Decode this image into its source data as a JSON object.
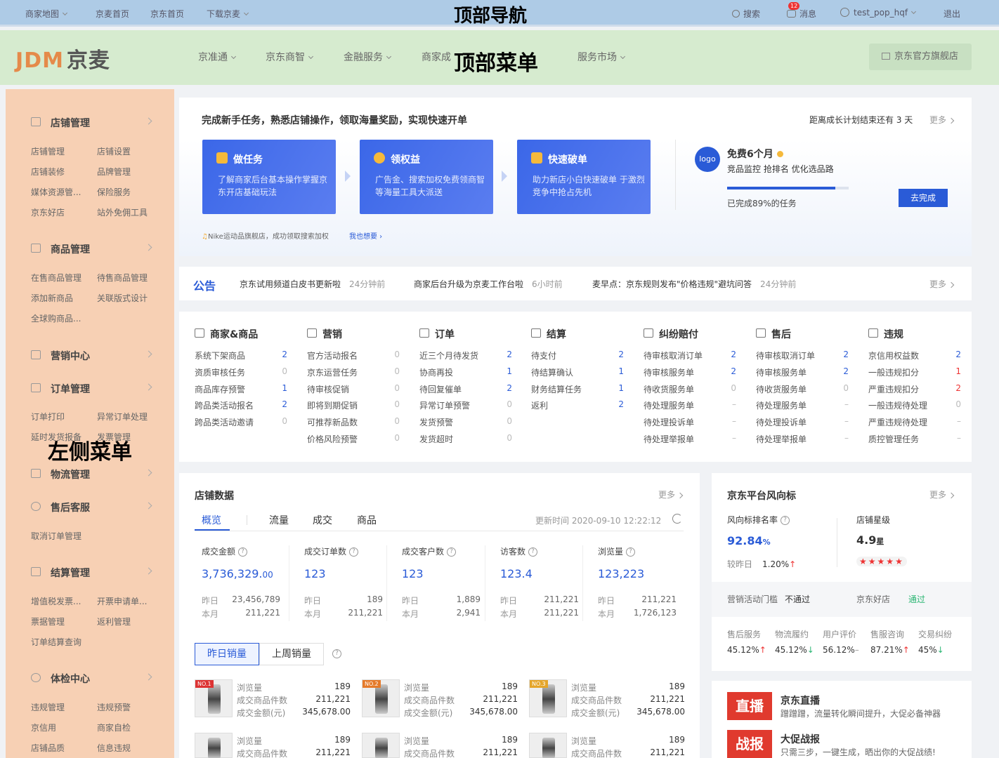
{
  "topbar": {
    "links": [
      "商家地图",
      "京麦首页",
      "京东首页",
      "下载京麦"
    ],
    "overlay": "顶部导航",
    "search": "搜索",
    "msg_badge": "12",
    "msg": "消息",
    "user": "test_pop_hqf",
    "logout": "退出"
  },
  "header": {
    "logo_en": "JDM",
    "logo_cn": "京麦",
    "menus": [
      "京准通",
      "京东商智",
      "金融服务",
      "商家成",
      "服务市场"
    ],
    "overlay": "顶部菜单",
    "store_btn": "京东官方旗舰店"
  },
  "sidebar": {
    "overlay": "左侧菜单",
    "groups": [
      {
        "title": "店铺管理",
        "items": [
          "店铺管理",
          "店铺设置",
          "店铺装修",
          "品牌管理",
          "媒体资源管...",
          "保险服务",
          "京东好店",
          "站外免佣工具"
        ]
      },
      {
        "title": "商品管理",
        "items": [
          "在售商品管理",
          "待售商品管理",
          "添加新商品",
          "关联版式设计",
          "全球购商品..."
        ]
      },
      {
        "title": "营销中心",
        "items": []
      },
      {
        "title": "订单管理",
        "items": [
          "订单打印",
          "异常订单处理",
          "延时发货报备",
          "发票管理"
        ]
      },
      {
        "title": "物流管理",
        "items": []
      },
      {
        "title": "售后客服",
        "items": [
          "取消订单管理"
        ]
      },
      {
        "title": "结算管理",
        "items": [
          "增值税发票...",
          "开票申请单...",
          "票据管理",
          "返利管理",
          "订单结算查询"
        ]
      },
      {
        "title": "体检中心",
        "items": [
          "违规管理",
          "违规预警",
          "京信用",
          "商家自检",
          "店铺品质",
          "信息违规"
        ]
      }
    ]
  },
  "tasks": {
    "title": "完成新手任务，熟悉店铺操作，领取海量奖励，实现快速开单",
    "countdown": "距离成长计划结束还有 3 天",
    "more": "更多",
    "cards": [
      {
        "title": "做任务",
        "desc": "了解商家后台基本操作掌握京东开店基础玩法"
      },
      {
        "title": "领权益",
        "desc": "广告金、搜索加权免费领商智等海量工具大派送"
      },
      {
        "title": "快速破单",
        "desc": "助力新店小白快速破单 于激烈竞争中抢占先机"
      }
    ],
    "notice": "Nike运动品旗舰店，成功领取搜索加权",
    "notice_link": "我也想要 ›",
    "promo_logo": "logo",
    "promo_title": "免费6个月",
    "promo_desc": "竞品监控  抢排名  优化选品路",
    "progress": 0.89,
    "progress_text": "已完成89%的任务",
    "go": "去完成"
  },
  "announce": {
    "label": "公告",
    "items": [
      {
        "text": "京东试用频道白皮书更新啦",
        "time": "24分钟前"
      },
      {
        "text": "商家后台升级为京麦工作台啦",
        "time": "6小时前"
      },
      {
        "text": "麦早点：京东规则发布\"价格违规\"避坑问答",
        "time": "24分钟前"
      }
    ],
    "more": "更多"
  },
  "todo": [
    {
      "title": "商家&商品",
      "rows": [
        [
          "系统下架商品",
          "2"
        ],
        [
          "资质审核任务",
          "0"
        ],
        [
          "商品库存预警",
          "1"
        ],
        [
          "跨品类活动报名",
          "2"
        ],
        [
          "跨品类活动邀请",
          "0"
        ]
      ]
    },
    {
      "title": "营销",
      "rows": [
        [
          "官方活动报名",
          "0"
        ],
        [
          "京东运营任务",
          "0"
        ],
        [
          "待审核促销",
          "0"
        ],
        [
          "即将到期促销",
          "0"
        ],
        [
          "可推荐新品数",
          "0"
        ],
        [
          "价格风险预警",
          "0"
        ]
      ]
    },
    {
      "title": "订单",
      "rows": [
        [
          "近三个月待发货",
          "2"
        ],
        [
          "协商再投",
          "1"
        ],
        [
          "待回复催单",
          "2"
        ],
        [
          "异常订单预警",
          "0"
        ],
        [
          "发货预警",
          "0"
        ],
        [
          "发货超时",
          "0"
        ]
      ]
    },
    {
      "title": "结算",
      "rows": [
        [
          "待支付",
          "2"
        ],
        [
          "待结算确认",
          "1"
        ],
        [
          "财务结算任务",
          "1"
        ],
        [
          "返利",
          "2"
        ]
      ]
    },
    {
      "title": "纠纷赔付",
      "rows": [
        [
          "待审核取消订单",
          "2"
        ],
        [
          "待审核服务单",
          "2"
        ],
        [
          "待收货服务单",
          "0"
        ],
        [
          "待处理服务单",
          "–"
        ],
        [
          "待处理投诉单",
          "–"
        ],
        [
          "待处理举报单",
          "–"
        ]
      ]
    },
    {
      "title": "售后",
      "rows": [
        [
          "待审核取消订单",
          "2"
        ],
        [
          "待审核服务单",
          "2"
        ],
        [
          "待收货服务单",
          "0"
        ],
        [
          "待处理服务单",
          "–"
        ],
        [
          "待处理投诉单",
          "–"
        ],
        [
          "待处理举报单",
          "–"
        ]
      ]
    },
    {
      "title": "违规",
      "rows": [
        [
          "京信用权益数",
          "2"
        ],
        [
          "一般违规扣分",
          "1"
        ],
        [
          "严重违规扣分",
          "2"
        ],
        [
          "一般违规待处理",
          "0"
        ],
        [
          "严重违规待处理",
          "–"
        ],
        [
          "质控管理任务",
          "–"
        ]
      ]
    }
  ],
  "store": {
    "title": "店铺数据",
    "more": "更多",
    "tabs": [
      "概览",
      "流量",
      "成交",
      "商品"
    ],
    "update": "更新时间 2020-09-10 12:22:12",
    "kpis": [
      {
        "label": "成交金额",
        "value": "3,736,329.",
        "dec": "00",
        "y": "23,456,789",
        "m": "211,221"
      },
      {
        "label": "成交订单数",
        "value": "123",
        "dec": "",
        "y": "189",
        "m": "211,221"
      },
      {
        "label": "成交客户数",
        "value": "123",
        "dec": "",
        "y": "1,889",
        "m": "2,941"
      },
      {
        "label": "访客数",
        "value": "123.4",
        "dec": "",
        "y": "211,221",
        "m": "211,221"
      },
      {
        "label": "浏览量",
        "value": "123,223",
        "dec": "",
        "y": "211,221",
        "m": "1,726,123"
      }
    ],
    "yday": "昨日",
    "month": "本月",
    "sales_tabs": [
      "昨日销量",
      "上周销量"
    ],
    "prod_labels": [
      "浏览量",
      "成交商品件数",
      "成交金额(元)"
    ],
    "products": [
      {
        "rank": "NO.1",
        "v": [
          "189",
          "211,221",
          "345,678.00"
        ]
      },
      {
        "rank": "NO.2",
        "v": [
          "189",
          "211,221",
          "345,678.00"
        ]
      },
      {
        "rank": "NO.3",
        "v": [
          "189",
          "211,221",
          "345,678.00"
        ]
      }
    ],
    "products2": [
      {
        "v": [
          "189",
          "211,221"
        ]
      },
      {
        "v": [
          "189",
          "211,221"
        ]
      },
      {
        "v": [
          "189",
          "211,221"
        ]
      }
    ]
  },
  "wind": {
    "title": "京东平台风向标",
    "more": "更多",
    "rate_label": "风向标排名率",
    "rate": "92.84",
    "pct": "%",
    "star_label": "店铺星级",
    "star": "4.9",
    "star_unit": "星",
    "vs": "较昨日",
    "vs_val": "1.20%",
    "mkt": "营销活动门槛",
    "mkt_val": "不通过",
    "good": "京东好店",
    "good_val": "通过",
    "metrics": [
      {
        "l": "售后服务",
        "v": "45.12%",
        "d": "↑"
      },
      {
        "l": "物流履约",
        "v": "45.12%",
        "d": "↓"
      },
      {
        "l": "用户评价",
        "v": "56.12%",
        "d": "–"
      },
      {
        "l": "售服咨询",
        "v": "87.21%",
        "d": "↑"
      },
      {
        "l": "交易纠纷",
        "v": "45%",
        "d": "↓"
      }
    ]
  },
  "live": {
    "t1": "京东直播",
    "d1": "蹭蹭蹭，流量转化瞬间提升，大促必备神器",
    "t2": "大促战报",
    "d2": "只需三步，一键生成，晒出你的大促战绩!",
    "b1": "直播",
    "b2": "战报"
  },
  "colors": {
    "accent": "#2a5bd7",
    "red": "#e33",
    "green": "#2bb673"
  }
}
